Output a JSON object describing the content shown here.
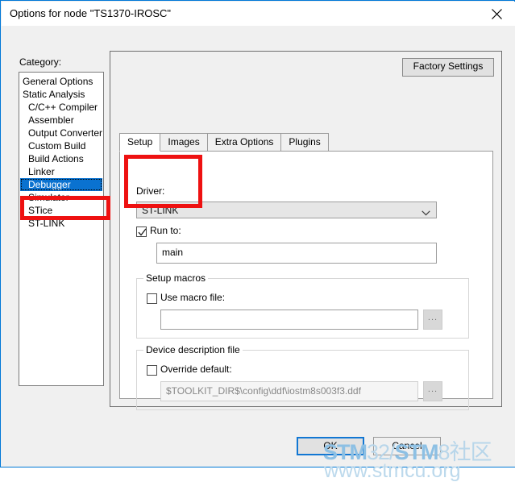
{
  "window": {
    "title": "Options for node \"TS1370-IROSC\"",
    "close_icon": "close-icon",
    "accent_color": "#0078d7"
  },
  "category": {
    "label": "Category:",
    "items": [
      {
        "label": "General Options",
        "indent": false,
        "selected": false
      },
      {
        "label": "Static Analysis",
        "indent": false,
        "selected": false
      },
      {
        "label": "C/C++ Compiler",
        "indent": true,
        "selected": false
      },
      {
        "label": "Assembler",
        "indent": true,
        "selected": false
      },
      {
        "label": "Output Converter",
        "indent": true,
        "selected": false
      },
      {
        "label": "Custom Build",
        "indent": true,
        "selected": false
      },
      {
        "label": "Build Actions",
        "indent": true,
        "selected": false
      },
      {
        "label": "Linker",
        "indent": true,
        "selected": false
      },
      {
        "label": "Debugger",
        "indent": true,
        "selected": true
      },
      {
        "label": "Simulator",
        "indent": true,
        "selected": false
      },
      {
        "label": "STice",
        "indent": true,
        "selected": false
      },
      {
        "label": "ST-LINK",
        "indent": true,
        "selected": false
      }
    ]
  },
  "panel": {
    "factory_settings_label": "Factory Settings",
    "tabs": [
      {
        "label": "Setup",
        "active": true
      },
      {
        "label": "Images",
        "active": false
      },
      {
        "label": "Extra Options",
        "active": false
      },
      {
        "label": "Plugins",
        "active": false
      }
    ]
  },
  "setup": {
    "driver": {
      "label": "Driver:",
      "value": "ST-LINK",
      "chevron_icon": "chevron-down-icon"
    },
    "run_to": {
      "label": "Run to:",
      "checked": true,
      "value": "main"
    },
    "setup_macros": {
      "title": "Setup macros",
      "use_macro_file": {
        "label": "Use macro file:",
        "checked": false
      },
      "macro_file_value": "",
      "browse_label": "..."
    },
    "device_description_file": {
      "title": "Device description file",
      "override_default": {
        "label": "Override default:",
        "checked": false
      },
      "path_value": "$TOOLKIT_DIR$\\config\\ddf\\iostm8s003f3.ddf",
      "browse_label": "..."
    }
  },
  "footer": {
    "ok_label": "OK",
    "cancel_label": "Cancel"
  },
  "watermark": {
    "line1_a": "STM",
    "line1_b": "32/",
    "line1_c": "STM",
    "line1_d": "8社区",
    "line2": "www.stmcu.org",
    "color": "#8dc0e4"
  },
  "annotations": {
    "highlight_color": "#ee1111",
    "boxes": [
      {
        "name": "debugger-category"
      },
      {
        "name": "driver-selection"
      }
    ]
  }
}
